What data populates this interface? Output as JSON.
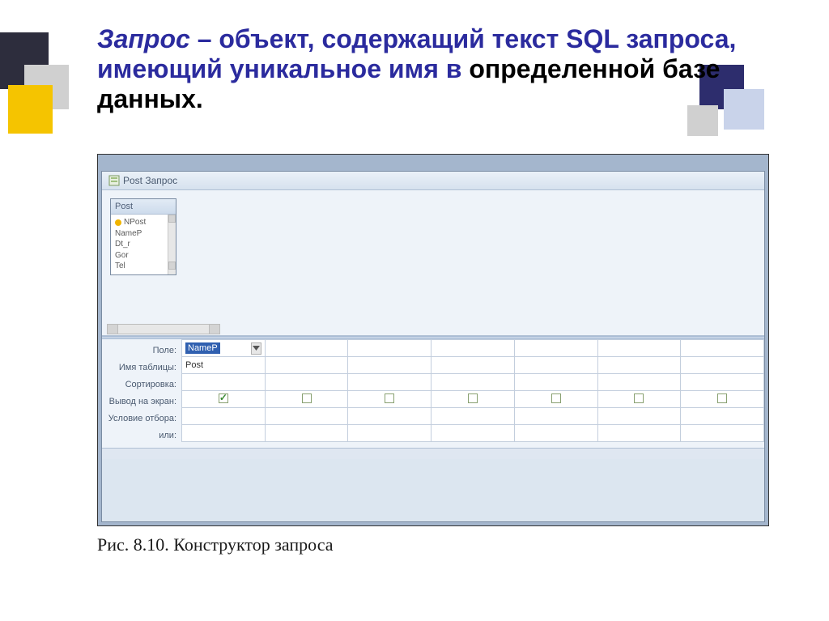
{
  "title": {
    "italic": "Запрос",
    "dash_rest": " – объект, содержащий текст SQL запроса, имеющий уникальное имя в ",
    "black": "определенной базе данных."
  },
  "query_tab": {
    "label": "Post Запрос"
  },
  "table_box": {
    "name": "Post",
    "fields": [
      "NPost",
      "NameP",
      "Dt_r",
      "Gor",
      "Tel"
    ]
  },
  "grid": {
    "row_labels": [
      "Поле:",
      "Имя таблицы:",
      "Сортировка:",
      "Вывод на экран:",
      "Условие отбора:",
      "или:"
    ],
    "columns": [
      {
        "field": "NameP",
        "table": "Post",
        "show": true
      },
      {
        "field": "",
        "table": "",
        "show": false
      },
      {
        "field": "",
        "table": "",
        "show": false
      },
      {
        "field": "",
        "table": "",
        "show": false
      },
      {
        "field": "",
        "table": "",
        "show": false
      },
      {
        "field": "",
        "table": "",
        "show": false
      },
      {
        "field": "",
        "table": "",
        "show": false
      }
    ]
  },
  "caption": "Рис. 8.10. Конструктор запроса"
}
